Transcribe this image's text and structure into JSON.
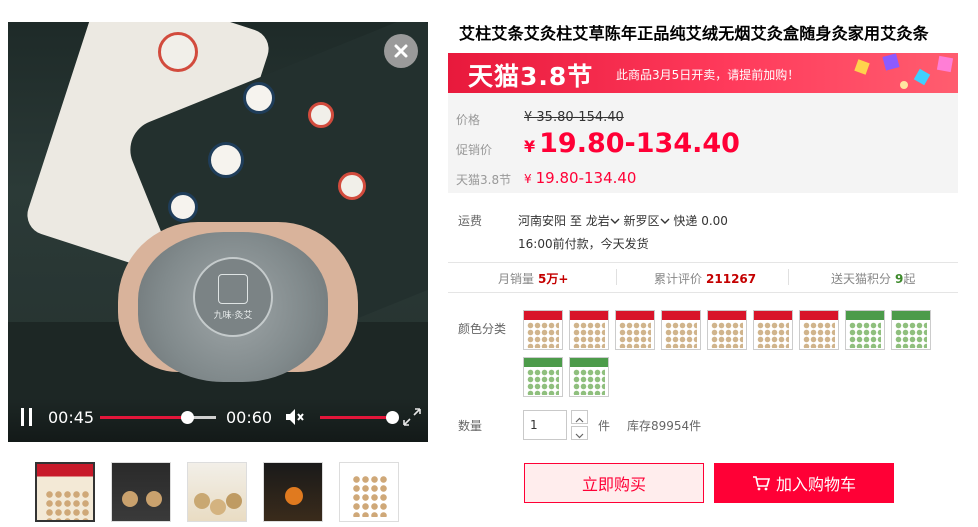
{
  "video": {
    "time_current": "00:45",
    "time_duration": "00:60",
    "progress_fraction": 0.75,
    "volume_fraction": 1.0,
    "pad_brand": "九味·灸艾"
  },
  "thumbnails": [
    {
      "name": "thumb-1",
      "active": true
    },
    {
      "name": "thumb-2",
      "active": false
    },
    {
      "name": "thumb-3",
      "active": false
    },
    {
      "name": "thumb-4",
      "active": false
    },
    {
      "name": "thumb-5",
      "active": false
    }
  ],
  "product": {
    "title": "艾柱艾条艾灸柱艾草陈年正品纯艾绒无烟艾灸盒随身灸家用艾灸条"
  },
  "promo": {
    "logo": "天猫3.8节",
    "text": "此商品3月5日开卖，请提前加购！"
  },
  "price": {
    "orig_label": "价格",
    "orig_value": "¥ 35.80-154.40",
    "sale_label": "促销价",
    "currency": "¥",
    "sale_value": "19.80-134.40",
    "event_label": "天猫3.8节",
    "event_value": "19.80-134.40"
  },
  "shipping": {
    "label": "运费",
    "from": "河南安阳",
    "to_word": "至",
    "city": "龙岩",
    "district": "新罗区",
    "express": "快递 0.00",
    "note": "16:00前付款，今天发货"
  },
  "stats": {
    "monthly_label": "月销量",
    "monthly_value": "5万+",
    "reviews_label": "累计评价",
    "reviews_value": "211267",
    "points_label": "送天猫积分",
    "points_value": "9",
    "points_suffix": "起"
  },
  "options": {
    "color_label": "颜色分类",
    "swatch_count": 11
  },
  "quantity": {
    "label": "数量",
    "value": "1",
    "unit": "件",
    "stock": "库存89954件"
  },
  "actions": {
    "buy_now": "立即购买",
    "add_to_cart": "加入购物车"
  },
  "colors": {
    "accent": "#ff0036",
    "banner": "#e8193c"
  }
}
